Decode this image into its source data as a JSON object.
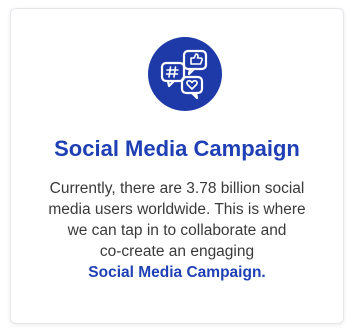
{
  "colors": {
    "accent": "#1f3fb4",
    "icon_circle": "#1d3aa8",
    "icon_stroke": "#ffffff",
    "text": "#3a3a3a",
    "card_border": "#e4e6ea"
  },
  "card": {
    "icon": "social-media-chat-icon",
    "title": "Social Media Campaign",
    "description_lines": [
      "Currently, there are 3.78 billion social",
      "media users worldwide. This is where",
      "we can tap in to collaborate and",
      "co-create an engaging"
    ],
    "highlight": "Social Media Campaign."
  }
}
